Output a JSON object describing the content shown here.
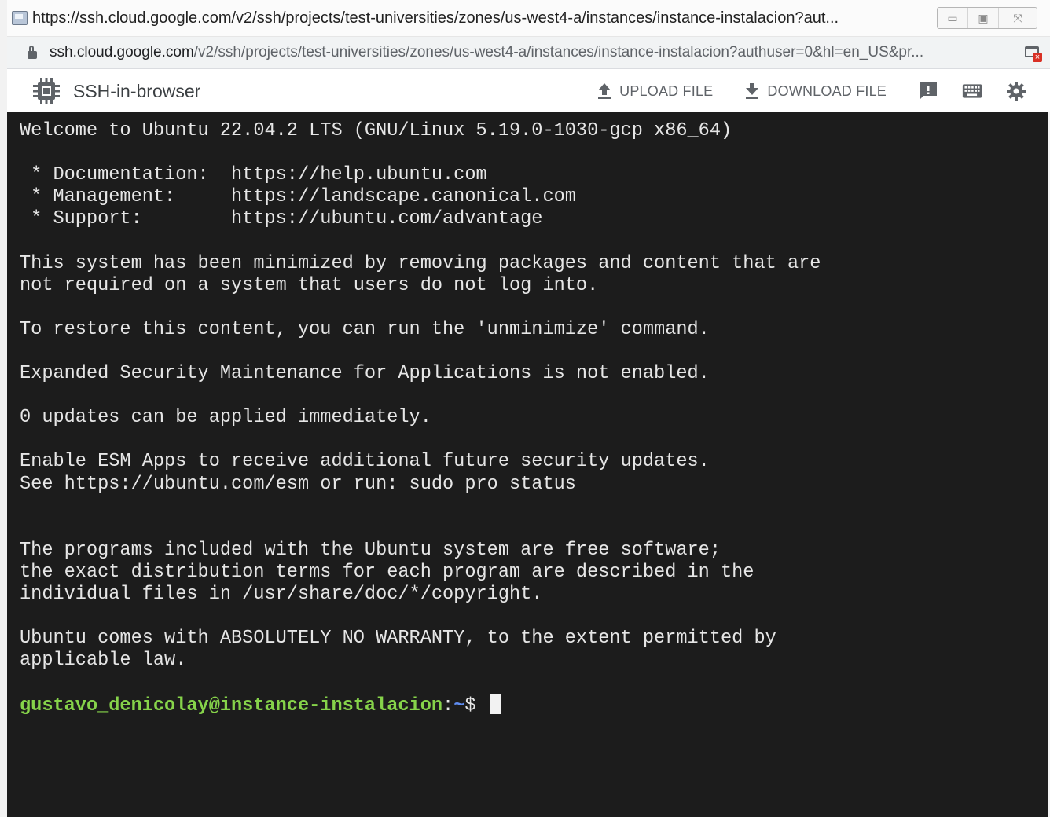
{
  "window": {
    "title": "https://ssh.cloud.google.com/v2/ssh/projects/test-universities/zones/us-west4-a/instances/instance-instalacion?aut...",
    "buttons": {
      "minimize": "▭",
      "maximize": "▣",
      "close": "⤧"
    }
  },
  "address": {
    "host": "ssh.cloud.google.com",
    "path": "/v2/ssh/projects/test-universities/zones/us-west4-a/instances/instance-instalacion?authuser=0&hl=en_US&pr..."
  },
  "toolbar": {
    "app_name": "SSH-in-browser",
    "upload_label": "UPLOAD FILE",
    "download_label": "DOWNLOAD FILE",
    "icons": [
      "feedback-icon",
      "keyboard-icon",
      "settings-icon"
    ]
  },
  "terminal": {
    "output": "Welcome to Ubuntu 22.04.2 LTS (GNU/Linux 5.19.0-1030-gcp x86_64)\n\n * Documentation:  https://help.ubuntu.com\n * Management:     https://landscape.canonical.com\n * Support:        https://ubuntu.com/advantage\n\nThis system has been minimized by removing packages and content that are\nnot required on a system that users do not log into.\n\nTo restore this content, you can run the 'unminimize' command.\n\nExpanded Security Maintenance for Applications is not enabled.\n\n0 updates can be applied immediately.\n\nEnable ESM Apps to receive additional future security updates.\nSee https://ubuntu.com/esm or run: sudo pro status\n\n\nThe programs included with the Ubuntu system are free software;\nthe exact distribution terms for each program are described in the\nindividual files in /usr/share/doc/*/copyright.\n\nUbuntu comes with ABSOLUTELY NO WARRANTY, to the extent permitted by\napplicable law.",
    "prompt_user": "gustavo_denicolay@instance-instalacion",
    "prompt_sep": ":",
    "prompt_path": "~",
    "prompt_dollar": "$ "
  },
  "colors": {
    "terminal_bg": "#1c1c1c",
    "terminal_fg": "#e6e6e6",
    "prompt_user": "#86d34a",
    "prompt_path": "#5f8cf0"
  }
}
